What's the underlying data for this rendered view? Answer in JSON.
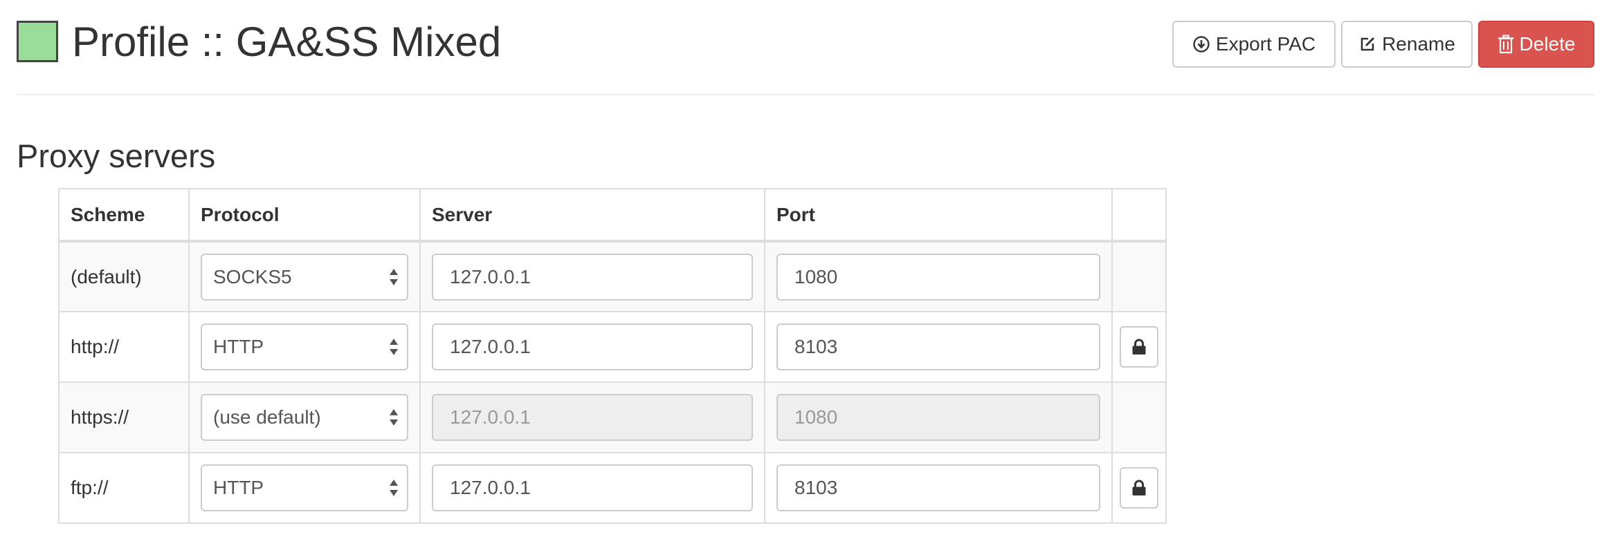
{
  "header": {
    "title": "Profile :: GA&SS Mixed",
    "profile_color": "#99dd99",
    "buttons": {
      "export_label": "Export PAC",
      "export_icon": "download-circle-icon",
      "rename_label": "Rename",
      "rename_icon": "edit-icon",
      "delete_label": "Delete",
      "delete_icon": "trash-icon",
      "delete_color": "#d9534f"
    }
  },
  "proxy_servers": {
    "title": "Proxy servers",
    "columns": [
      "Scheme",
      "Protocol",
      "Server",
      "Port",
      ""
    ],
    "rows": [
      {
        "scheme": "(default)",
        "protocol": "SOCKS5",
        "server": "127.0.0.1",
        "port": "1080",
        "disabled": false,
        "auth_icon": ""
      },
      {
        "scheme": "http://",
        "protocol": "HTTP",
        "server": "127.0.0.1",
        "port": "8103",
        "disabled": false,
        "auth_icon": "lock-icon"
      },
      {
        "scheme": "https://",
        "protocol": "(use default)",
        "server": "127.0.0.1",
        "port": "1080",
        "disabled": true,
        "auth_icon": ""
      },
      {
        "scheme": "ftp://",
        "protocol": "HTTP",
        "server": "127.0.0.1",
        "port": "8103",
        "disabled": false,
        "auth_icon": "lock-icon"
      }
    ]
  }
}
